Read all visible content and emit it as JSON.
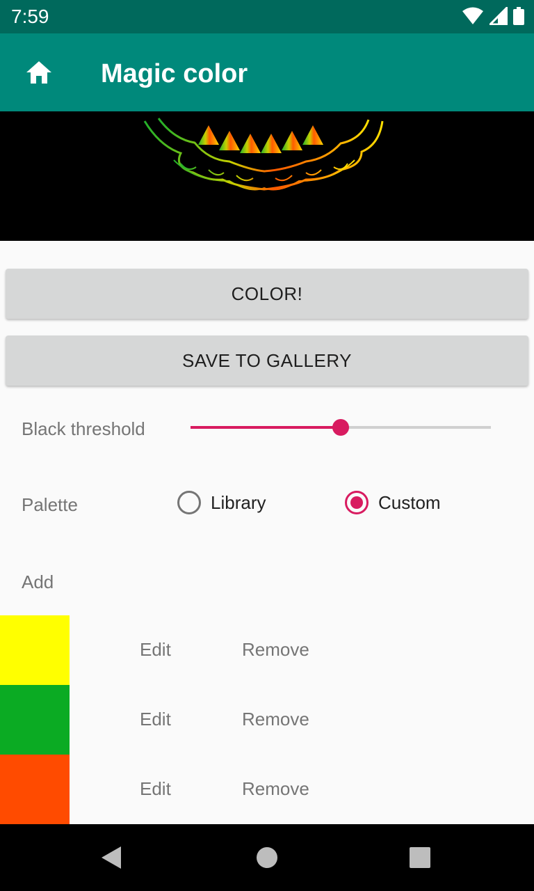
{
  "status_bar": {
    "time": "7:59",
    "icons": [
      "wifi-icon",
      "cell-signal-icon",
      "battery-icon"
    ]
  },
  "app_bar": {
    "title": "Magic color",
    "icon": "home-icon",
    "color": "#00897b"
  },
  "buttons": {
    "color_label": "COLOR!",
    "save_label": "SAVE TO GALLERY"
  },
  "threshold": {
    "label": "Black threshold",
    "value_fraction": 0.5
  },
  "palette": {
    "label": "Palette",
    "options": [
      {
        "label": "Library",
        "selected": false
      },
      {
        "label": "Custom",
        "selected": true
      }
    ]
  },
  "add_label": "Add",
  "colors": [
    {
      "hex": "#ffff00",
      "edit": "Edit",
      "remove": "Remove"
    },
    {
      "hex": "#0bab23",
      "edit": "Edit",
      "remove": "Remove"
    },
    {
      "hex": "#ff4b00",
      "edit": "Edit",
      "remove": "Remove"
    }
  ],
  "accent_color": "#d81b60",
  "nav_bar": {
    "icons": [
      "back-icon",
      "home-circle-icon",
      "recents-icon"
    ]
  }
}
